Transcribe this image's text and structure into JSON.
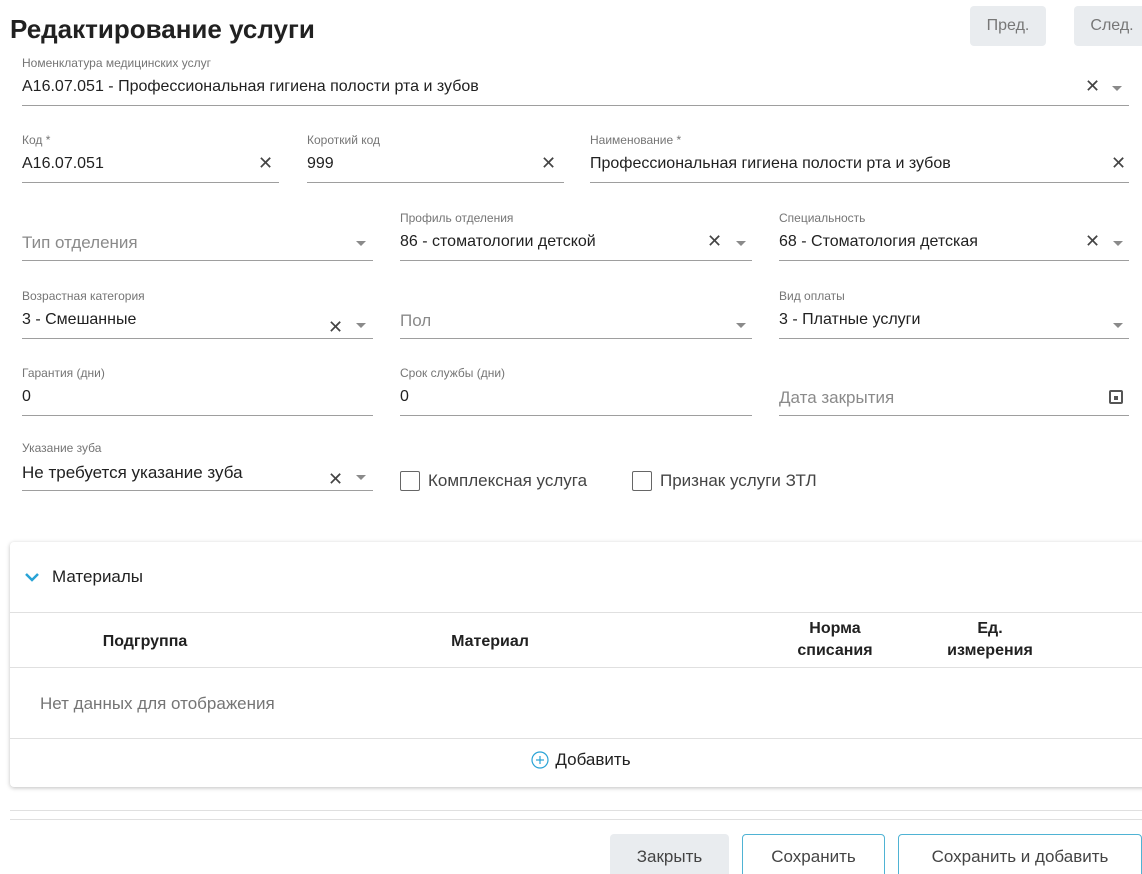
{
  "header": {
    "title": "Редактирование услуги",
    "prev_label": "Пред.",
    "next_label": "След."
  },
  "nomenclature": {
    "label": "Номенклатура медицинских услуг",
    "value": "A16.07.051 - Профессиональная гигиена полости рта и зубов"
  },
  "code": {
    "label": "Код *",
    "value": "A16.07.051"
  },
  "short_code": {
    "label": "Короткий код",
    "value": "999"
  },
  "name": {
    "label": "Наименование *",
    "value": "Профессиональная гигиена полости рта и зубов"
  },
  "department_type": {
    "placeholder": "Тип отделения"
  },
  "department_profile": {
    "label": "Профиль отделения",
    "value": "86 - стоматологии детской"
  },
  "specialty": {
    "label": "Специальность",
    "value": "68 - Стоматология детская"
  },
  "age_category": {
    "label": "Возрастная категория",
    "value": "3 - Смешанные"
  },
  "sex": {
    "placeholder": "Пол"
  },
  "payment_type": {
    "label": "Вид оплаты",
    "value": "3 - Платные услуги"
  },
  "warranty": {
    "label": "Гарантия (дни)",
    "value": "0"
  },
  "service_life": {
    "label": "Срок службы (дни)",
    "value": "0"
  },
  "close_date": {
    "placeholder": "Дата закрытия"
  },
  "tooth": {
    "label": "Указание зуба",
    "value": "Не требуется указание зуба"
  },
  "checkboxes": {
    "complex": "Комплексная услуга",
    "ztl": "Признак услуги ЗТЛ"
  },
  "materials": {
    "title": "Материалы",
    "columns": {
      "subgroup": "Подгруппа",
      "material": "Материал",
      "norm_1": "Норма",
      "norm_2": "списания",
      "unit_1": "Ед.",
      "unit_2": "измерения"
    },
    "empty": "Нет данных для отображения",
    "add": "Добавить"
  },
  "footer": {
    "close": "Закрыть",
    "save": "Сохранить",
    "save_add": "Сохранить и добавить"
  },
  "colors": {
    "accent": "#4fb3d4",
    "chevron": "#29a3d6"
  }
}
